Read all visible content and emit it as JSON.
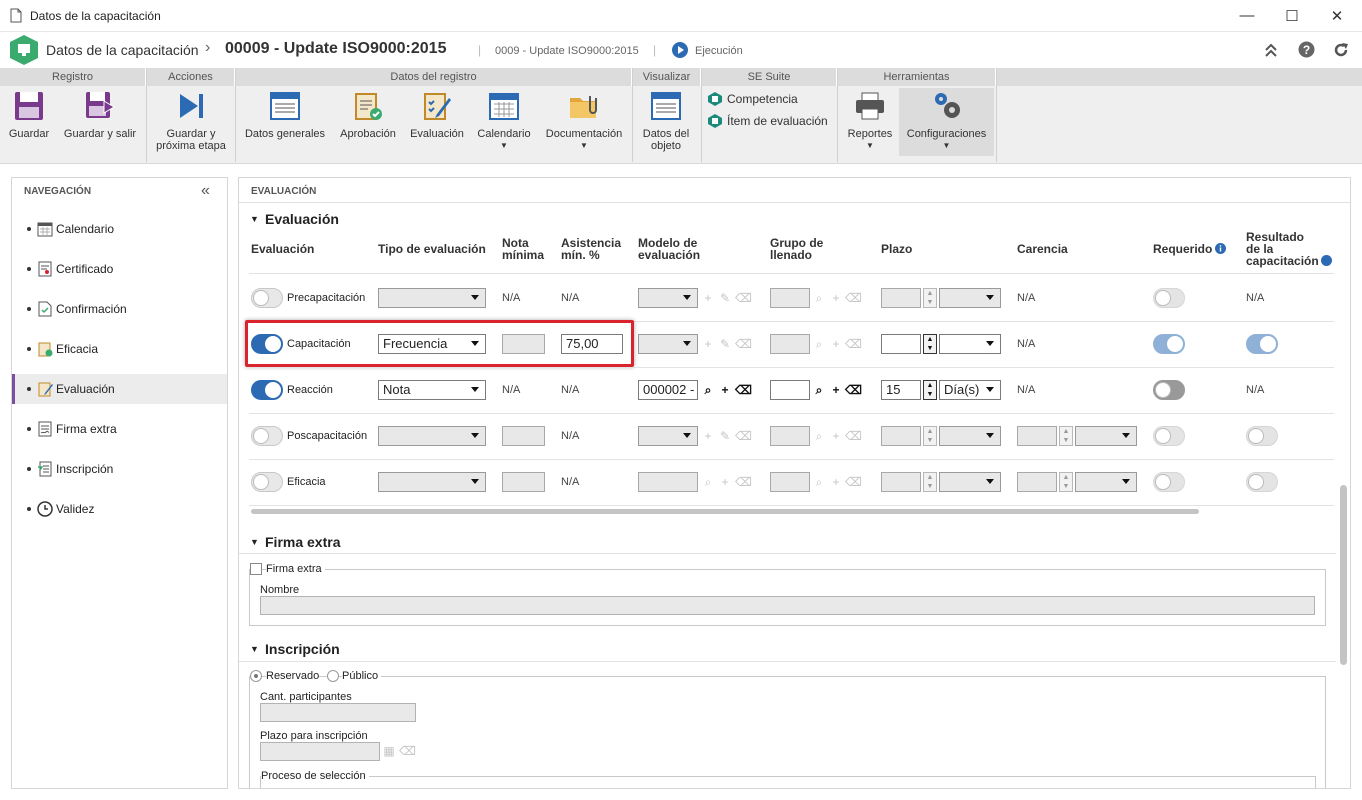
{
  "window": {
    "title": "Datos de la capacitación",
    "minimize": "—",
    "maximize": "☐",
    "close": "✕"
  },
  "header": {
    "module": "Datos de la capacitación",
    "record": "00009 - Update ISO9000:2015",
    "sub": "0009 - Update ISO9000:2015",
    "status": "Ejecución"
  },
  "toolbar": {
    "groups": [
      "Registro",
      "Acciones",
      "Datos del registro",
      "Visualizar",
      "SE Suite",
      "Herramientas"
    ],
    "save": "Guardar",
    "save_exit": "Guardar y salir",
    "save_next_1": "Guardar y",
    "save_next_2": "próxima etapa",
    "general": "Datos generales",
    "approval": "Aprobación",
    "evaluation": "Evaluación",
    "calendar": "Calendario",
    "documentation": "Documentación",
    "object_1": "Datos del",
    "object_2": "objeto",
    "competence": "Competencia",
    "eval_item": "Ítem de evaluación",
    "reports": "Reportes",
    "config": "Configuraciones"
  },
  "nav": {
    "title": "NAVEGACIÓN",
    "items": [
      "Calendario",
      "Certificado",
      "Confirmación",
      "Eficacia",
      "Evaluación",
      "Firma extra",
      "Inscripción",
      "Validez"
    ]
  },
  "main": {
    "title": "EVALUACIÓN",
    "sec_eval": "Evaluación",
    "sec_firma": "Firma extra",
    "sec_insc": "Inscripción",
    "cols": {
      "eval": "Evaluación",
      "tipo": "Tipo de evaluación",
      "nota1": "Nota",
      "nota2": "mínima",
      "asis1": "Asistencia",
      "asis2": "mín. %",
      "mod1": "Modelo de",
      "mod2": "evaluación",
      "grupo1": "Grupo de",
      "grupo2": "llenado",
      "plazo": "Plazo",
      "carencia": "Carencia",
      "requerido": "Requerido",
      "res1": "Resultado",
      "res2": "de la",
      "res3": "capacitación"
    },
    "rows": [
      {
        "name": "Precapacitación",
        "tipo": "",
        "asis": "N/A",
        "nota": "N/A",
        "carencia": "N/A",
        "resultado": "N/A"
      },
      {
        "name": "Capacitación",
        "tipo": "Frecuencia",
        "asis": "75,00",
        "carencia": "N/A"
      },
      {
        "name": "Reacción",
        "tipo": "Nota",
        "nota": "N/A",
        "asis": "N/A",
        "modelo": "000002 -",
        "plazo": "15",
        "plazo_unit": "Día(s)",
        "carencia": "N/A",
        "resultado": "N/A"
      },
      {
        "name": "Poscapacitación",
        "asis": "N/A"
      },
      {
        "name": "Eficacia",
        "asis": "N/A"
      }
    ],
    "firma": {
      "check": "Firma extra",
      "nombre": "Nombre"
    },
    "insc": {
      "reservado": "Reservado",
      "publico": "Público",
      "cant": "Cant. participantes",
      "plazo": "Plazo para inscripción",
      "proceso": "Proceso de selección"
    }
  },
  "colors": {
    "accent": "#2c6bb3",
    "highlight": "#d9232d",
    "nav_active": "#7a4fa0"
  }
}
